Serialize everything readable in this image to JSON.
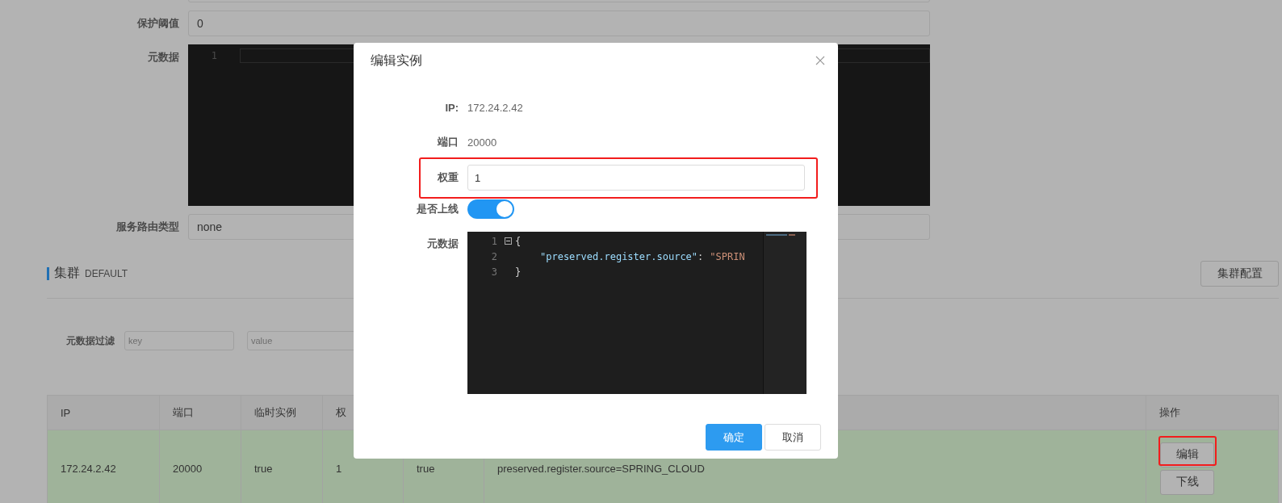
{
  "form": {
    "fields": [
      {
        "kind": "input",
        "label": "保护阈值",
        "value": "0"
      },
      {
        "kind": "editor",
        "label": "元数据",
        "line_numbers": [
          "1"
        ]
      },
      {
        "kind": "input",
        "label": "服务路由类型",
        "value": "none"
      }
    ]
  },
  "cluster": {
    "title": "集群",
    "name": "DEFAULT",
    "config_button": "集群配置"
  },
  "filter": {
    "label": "元数据过滤",
    "key_placeholder": "key",
    "value_placeholder": "value"
  },
  "table": {
    "columns": [
      "IP",
      "端口",
      "临时实例",
      "权"
    ],
    "action_column": "操作",
    "rows": [
      {
        "cells": [
          "172.24.2.42",
          "20000",
          "true",
          "1",
          "true",
          "preserved.register.source=SPRING_CLOUD"
        ],
        "actions": [
          {
            "label": "编辑",
            "highlighted": true
          },
          {
            "label": "下线",
            "highlighted": false
          }
        ]
      }
    ]
  },
  "dialog": {
    "title": "编辑实例",
    "fields": [
      {
        "kind": "text",
        "label": "IP:",
        "value": "172.24.2.42"
      },
      {
        "kind": "text",
        "label": "端口",
        "value": "20000"
      },
      {
        "kind": "input",
        "label": "权重",
        "value": "1",
        "highlighted": true
      },
      {
        "kind": "switch",
        "label": "是否上线",
        "on": true
      },
      {
        "kind": "editor",
        "label": "元数据",
        "lines": [
          {
            "number": "1",
            "foldable": true,
            "tokens": [
              {
                "kind": "punct",
                "text": "{"
              }
            ]
          },
          {
            "number": "2",
            "foldable": false,
            "tokens": [
              {
                "kind": "key",
                "text": "\"preserved.register.source\""
              },
              {
                "kind": "punct",
                "text": ":"
              },
              {
                "kind": "string",
                "text": "\"SPRIN"
              }
            ]
          },
          {
            "number": "3",
            "foldable": false,
            "tokens": [
              {
                "kind": "punct",
                "text": "}"
              }
            ]
          }
        ]
      }
    ],
    "buttons": [
      {
        "label": "确定",
        "primary": true
      },
      {
        "label": "取消",
        "primary": false
      }
    ]
  }
}
